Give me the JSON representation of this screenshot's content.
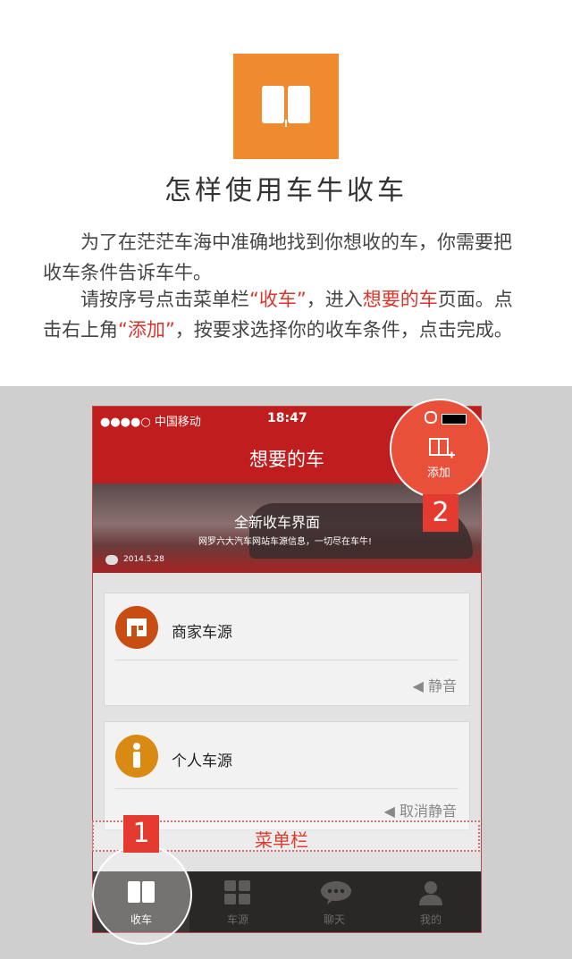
{
  "header": {
    "title": "怎样使用车牛收车",
    "paragraph1": "为了在茫茫车海中准确地找到你想收的车，你需要把收车条件告诉车牛。",
    "paragraph2_part1": "请按序号点击菜单栏",
    "paragraph2_hl1": "“收车”",
    "paragraph2_part2": "，进入",
    "paragraph2_hl2": "想要的车",
    "paragraph2_part3": "页面。点击右上角",
    "paragraph2_hl3": "“添加”",
    "paragraph2_part4": "，按要求选择你的收车条件，点击完成。"
  },
  "phone": {
    "status": {
      "carrier": "●●●●○ 中国移动",
      "time": "18:47"
    },
    "nav": {
      "title": "想要的车",
      "add_label": "添加"
    },
    "banner": {
      "title": "全新收车界面",
      "subtitle": "网罗六大汽车网站车源信息，一切尽在车牛!",
      "date": "2014.5.28"
    },
    "cards": [
      {
        "name": "商家车源",
        "mute": "静音"
      },
      {
        "name": "个人车源",
        "mute": "取消静音"
      }
    ],
    "tabs": [
      {
        "label": "收车"
      },
      {
        "label": "车源"
      },
      {
        "label": "聊天"
      },
      {
        "label": "我的"
      }
    ]
  },
  "annotations": {
    "menu_label": "菜单栏",
    "step1": "1",
    "step2": "2"
  },
  "colors": {
    "brand_orange": "#ef8a2e",
    "nav_red": "#c01e1e",
    "highlight_red": "#d9342b"
  }
}
